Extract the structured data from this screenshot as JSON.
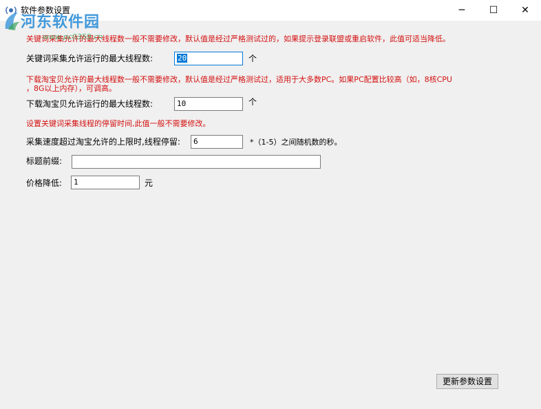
{
  "window": {
    "title": "软件参数设置",
    "controls": {
      "minimize": "─",
      "maximize": "☐",
      "close": "✕"
    }
  },
  "watermark": {
    "text": "河东软件园",
    "url": "www.pc0359.cn"
  },
  "keyword": {
    "note": "关键词采集允许的最大线程数一般不需要修改，默认值是经过严格测试过的，如果提示登录联盟或重启软件，此值可适当降低。",
    "label": "关键词采集允许运行的最大线程数:",
    "value": "20",
    "unit": "个"
  },
  "download": {
    "note_line1": "下载淘宝贝允许的最大线程数一般不需要修改，默认值是经过严格测试过，适用于大多数PC。如果PC配置比较高（如，8核CPU",
    "note_line2": "，8G以上内存），可调高。",
    "label": "下载淘宝贝允许运行的最大线程数:",
    "value": "10",
    "unit": "个"
  },
  "pause": {
    "note": "设置关键词采集线程的停留时间,此值一般不需要修改。",
    "label": "采集速度超过淘宝允许的上限时,线程停留:",
    "value": "6",
    "suffix": "*（1-5）之间随机数的秒。"
  },
  "title_prefix": {
    "label": "标题前缀:",
    "value": ""
  },
  "price_reduce": {
    "label": "价格降低:",
    "value": "1",
    "unit": "元"
  },
  "update_button": {
    "label": "更新参数设置"
  },
  "colors": {
    "note_red": "#d41010",
    "window_bg": "#f0f0f0",
    "selection": "#0078d7"
  }
}
